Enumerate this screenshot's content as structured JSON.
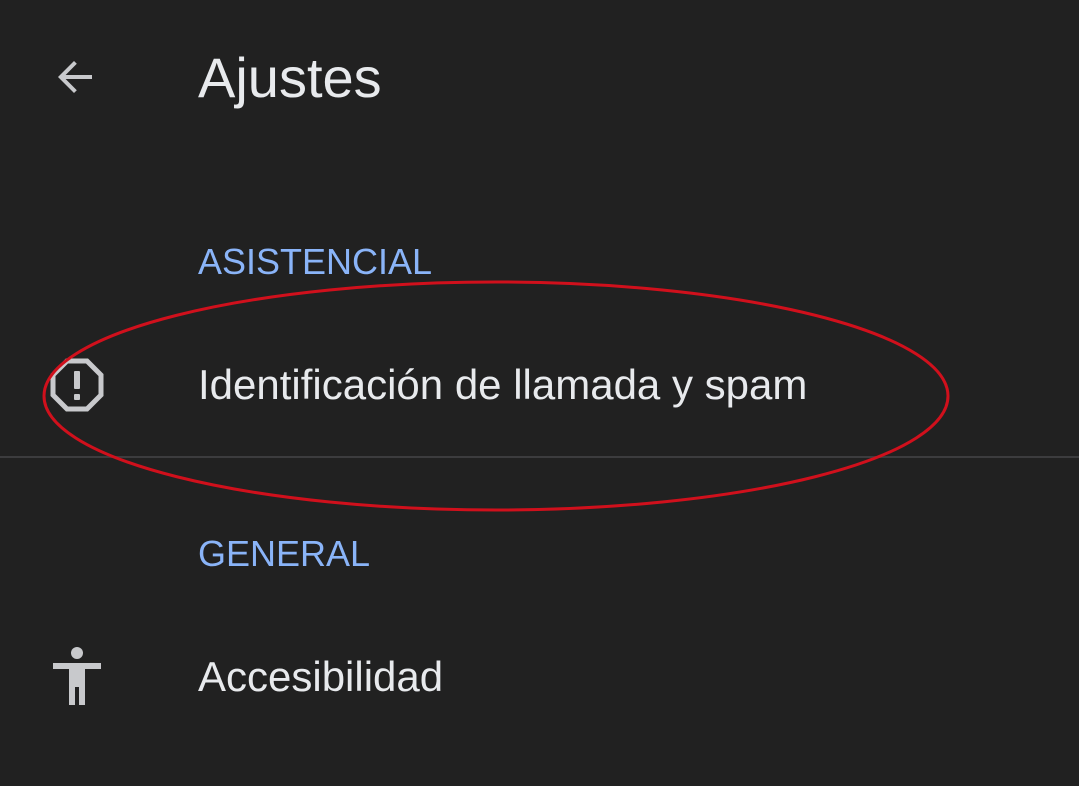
{
  "header": {
    "back_icon": "arrow-left-icon",
    "title": "Ajustes"
  },
  "sections": [
    {
      "header": "ASISTENCIAL",
      "items": [
        {
          "label": "Identificación de llamada y spam",
          "icon": "alert-octagon-icon"
        }
      ]
    },
    {
      "header": "GENERAL",
      "items": [
        {
          "label": "Accesibilidad",
          "icon": "accessibility-icon"
        }
      ]
    }
  ],
  "colors": {
    "background": "#212121",
    "text_primary": "#e8eaed",
    "section_header": "#8ab4f8",
    "annotation_ellipse": "#d0101c"
  }
}
